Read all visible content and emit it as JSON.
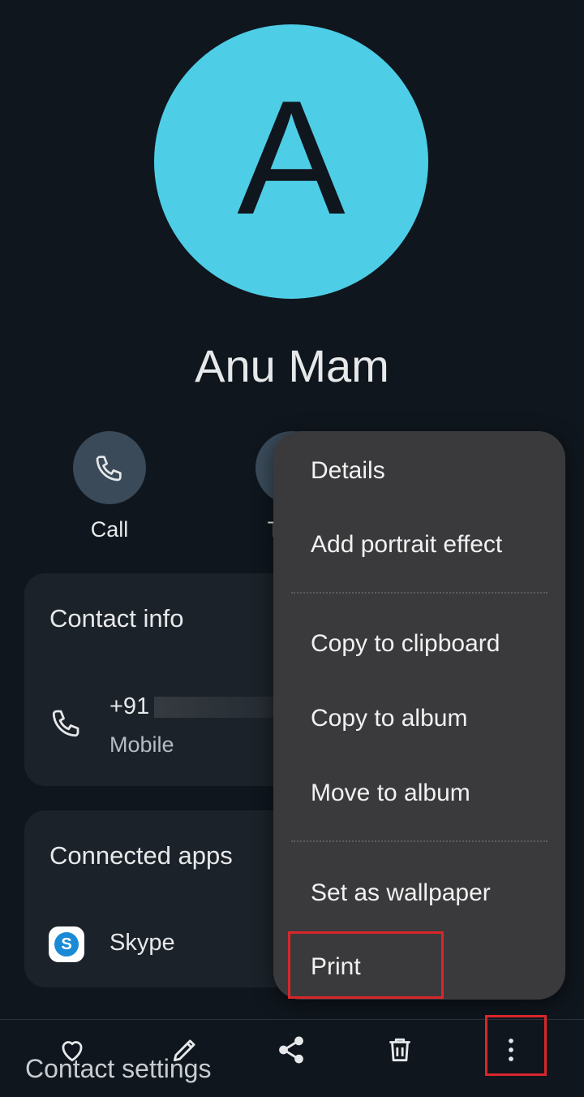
{
  "contact": {
    "avatar_letter": "A",
    "avatar_color": "#4ecde6",
    "name": "Anu Mam"
  },
  "actions": {
    "call_label": "Call",
    "text_label_partial": "T"
  },
  "contact_info": {
    "title": "Contact info",
    "phone_prefix": "+91",
    "phone_type": "Mobile"
  },
  "connected_apps": {
    "title": "Connected apps",
    "items": [
      {
        "label": "Skype",
        "icon": "skype-icon"
      }
    ]
  },
  "menu": {
    "items": [
      {
        "label": "Details"
      },
      {
        "label": "Add portrait effect"
      },
      {
        "label": "Copy to clipboard"
      },
      {
        "label": "Copy to album"
      },
      {
        "label": "Move to album"
      },
      {
        "label": "Set as wallpaper"
      },
      {
        "label": "Print"
      }
    ],
    "highlight_color": "#d9262b"
  },
  "bottom_bar": {
    "icons": [
      "heart-icon",
      "edit-pencil-icon",
      "share-icon",
      "trash-icon",
      "more-vert-icon"
    ],
    "contact_settings_label": "Contact settings"
  }
}
